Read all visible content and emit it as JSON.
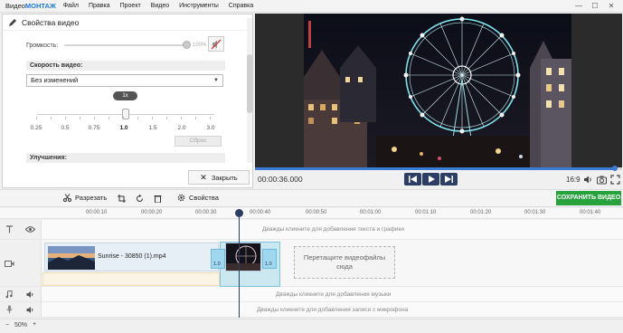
{
  "app": {
    "logo_prefix": "Видео",
    "logo_brand": "МОНТАЖ",
    "menu": [
      "Файл",
      "Правка",
      "Проект",
      "Видео",
      "Инструменты",
      "Справка"
    ]
  },
  "properties_panel": {
    "title": "Свойства видео",
    "volume_label": "Громкость:",
    "volume_percent": "100%",
    "volume_level": 1.0,
    "speed_section_label": "Скорость видео:",
    "speed_select_value": "Без изменений",
    "speed_bubble": "1x",
    "speed_ticks": [
      "0.25",
      "0.5",
      "0.75",
      "1.0",
      "1.5",
      "2.0",
      "3.0"
    ],
    "selected_tick": "1.0",
    "reset_label": "Сброс",
    "improvements_label": "Улучшения:",
    "close_label": "Закрыть"
  },
  "player": {
    "timecode": "00:00:36.000",
    "progress": 0.98,
    "aspect_ratio": "16:9"
  },
  "toolbar": {
    "cut_label": "Разрезать",
    "properties_label": "Свойства",
    "save_label": "СОХРАНИТЬ ВИДЕО"
  },
  "timeline": {
    "ruler": [
      "00:00:10",
      "00:00:20",
      "00:00:30",
      "00:00:40",
      "00:00:50",
      "00:01:00",
      "00:01:10",
      "00:01:20",
      "00:01:30",
      "00:01:40"
    ],
    "text_hint": "Дважды кликните для добавления текста и графики",
    "clip_name": "Sunrise - 30850 (1).mp4",
    "transition_a_label": "1.0",
    "transition_b_label": "1.0",
    "drop_hint": "Перетащите видеофайлы сюда",
    "music_hint": "Дважды кликните для добавления музыки",
    "mic_hint": "Дважды кликните для добавления записи с микрофона",
    "zoom_label": "50%"
  }
}
